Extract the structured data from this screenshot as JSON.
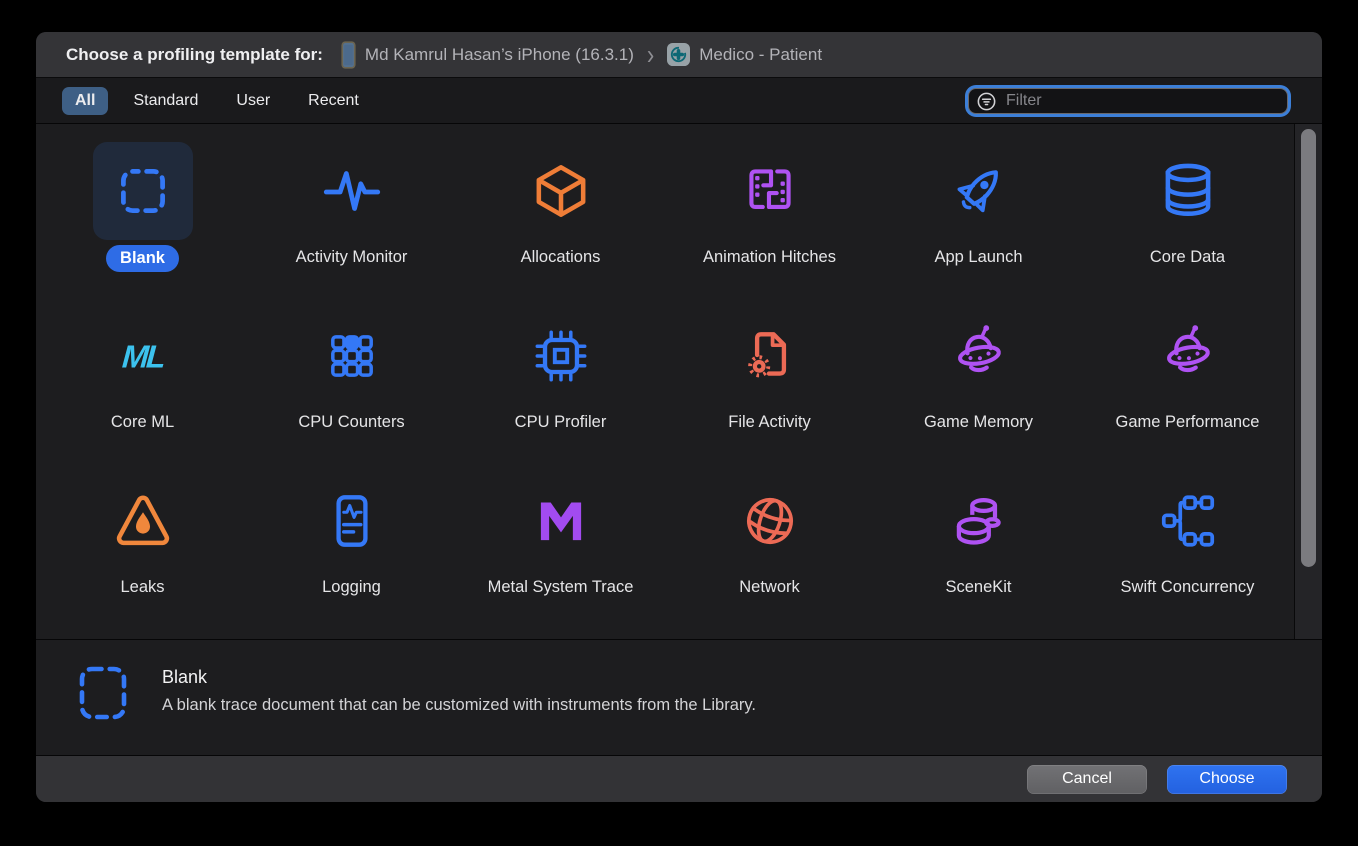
{
  "header": {
    "title": "Choose a profiling template for:",
    "device_name": "Md Kamrul Hasan’s iPhone (16.3.1)",
    "separator": "›",
    "app_name": "Medico - Patient"
  },
  "tabs": [
    {
      "label": "All",
      "selected": true
    },
    {
      "label": "Standard",
      "selected": false
    },
    {
      "label": "User",
      "selected": false
    },
    {
      "label": "Recent",
      "selected": false
    }
  ],
  "filter": {
    "placeholder": "Filter",
    "icon": "filter-icon"
  },
  "templates": [
    {
      "name": "Blank",
      "icon": "blank",
      "color": "#3478f6",
      "selected": true
    },
    {
      "name": "Activity Monitor",
      "icon": "activity-monitor",
      "color": "#3478f6",
      "selected": false
    },
    {
      "name": "Allocations",
      "icon": "allocations",
      "color": "#ef7d37",
      "selected": false
    },
    {
      "name": "Animation Hitches",
      "icon": "animation-hitches",
      "color": "#af52f2",
      "selected": false
    },
    {
      "name": "App Launch",
      "icon": "app-launch",
      "color": "#3478f6",
      "selected": false
    },
    {
      "name": "Core Data",
      "icon": "core-data",
      "color": "#3478f6",
      "selected": false
    },
    {
      "name": "Core ML",
      "icon": "core-ml",
      "color": "#3cc2ee",
      "selected": false
    },
    {
      "name": "CPU Counters",
      "icon": "cpu-counters",
      "color": "#3478f6",
      "selected": false
    },
    {
      "name": "CPU Profiler",
      "icon": "cpu-profiler",
      "color": "#3478f6",
      "selected": false
    },
    {
      "name": "File Activity",
      "icon": "file-activity",
      "color": "#ec6a55",
      "selected": false
    },
    {
      "name": "Game Memory",
      "icon": "game-memory",
      "color": "#af52f2",
      "selected": false
    },
    {
      "name": "Game Performance",
      "icon": "game-performance",
      "color": "#af52f2",
      "selected": false
    },
    {
      "name": "Leaks",
      "icon": "leaks",
      "color": "#f0873c",
      "selected": false
    },
    {
      "name": "Logging",
      "icon": "logging",
      "color": "#3478f6",
      "selected": false
    },
    {
      "name": "Metal System Trace",
      "icon": "metal",
      "color": "#a24bf0",
      "selected": false
    },
    {
      "name": "Network",
      "icon": "network",
      "color": "#ec6a55",
      "selected": false
    },
    {
      "name": "SceneKit",
      "icon": "scenekit",
      "color": "#af52f2",
      "selected": false
    },
    {
      "name": "Swift Concurrency",
      "icon": "swift-concurrency",
      "color": "#3478f6",
      "selected": false
    }
  ],
  "detail": {
    "title": "Blank",
    "description": "A blank trace document that can be customized with instruments from the Library.",
    "icon": "blank",
    "icon_color": "#3478f6"
  },
  "footer": {
    "cancel_label": "Cancel",
    "choose_label": "Choose"
  },
  "colors": {
    "accent_blue": "#2e6ce6",
    "selected_tab_bg": "#3e5f85",
    "selection_box_bg": "#202a3b",
    "focus_ring": "#3c7fd8",
    "cancel_gray": "#69696c"
  }
}
